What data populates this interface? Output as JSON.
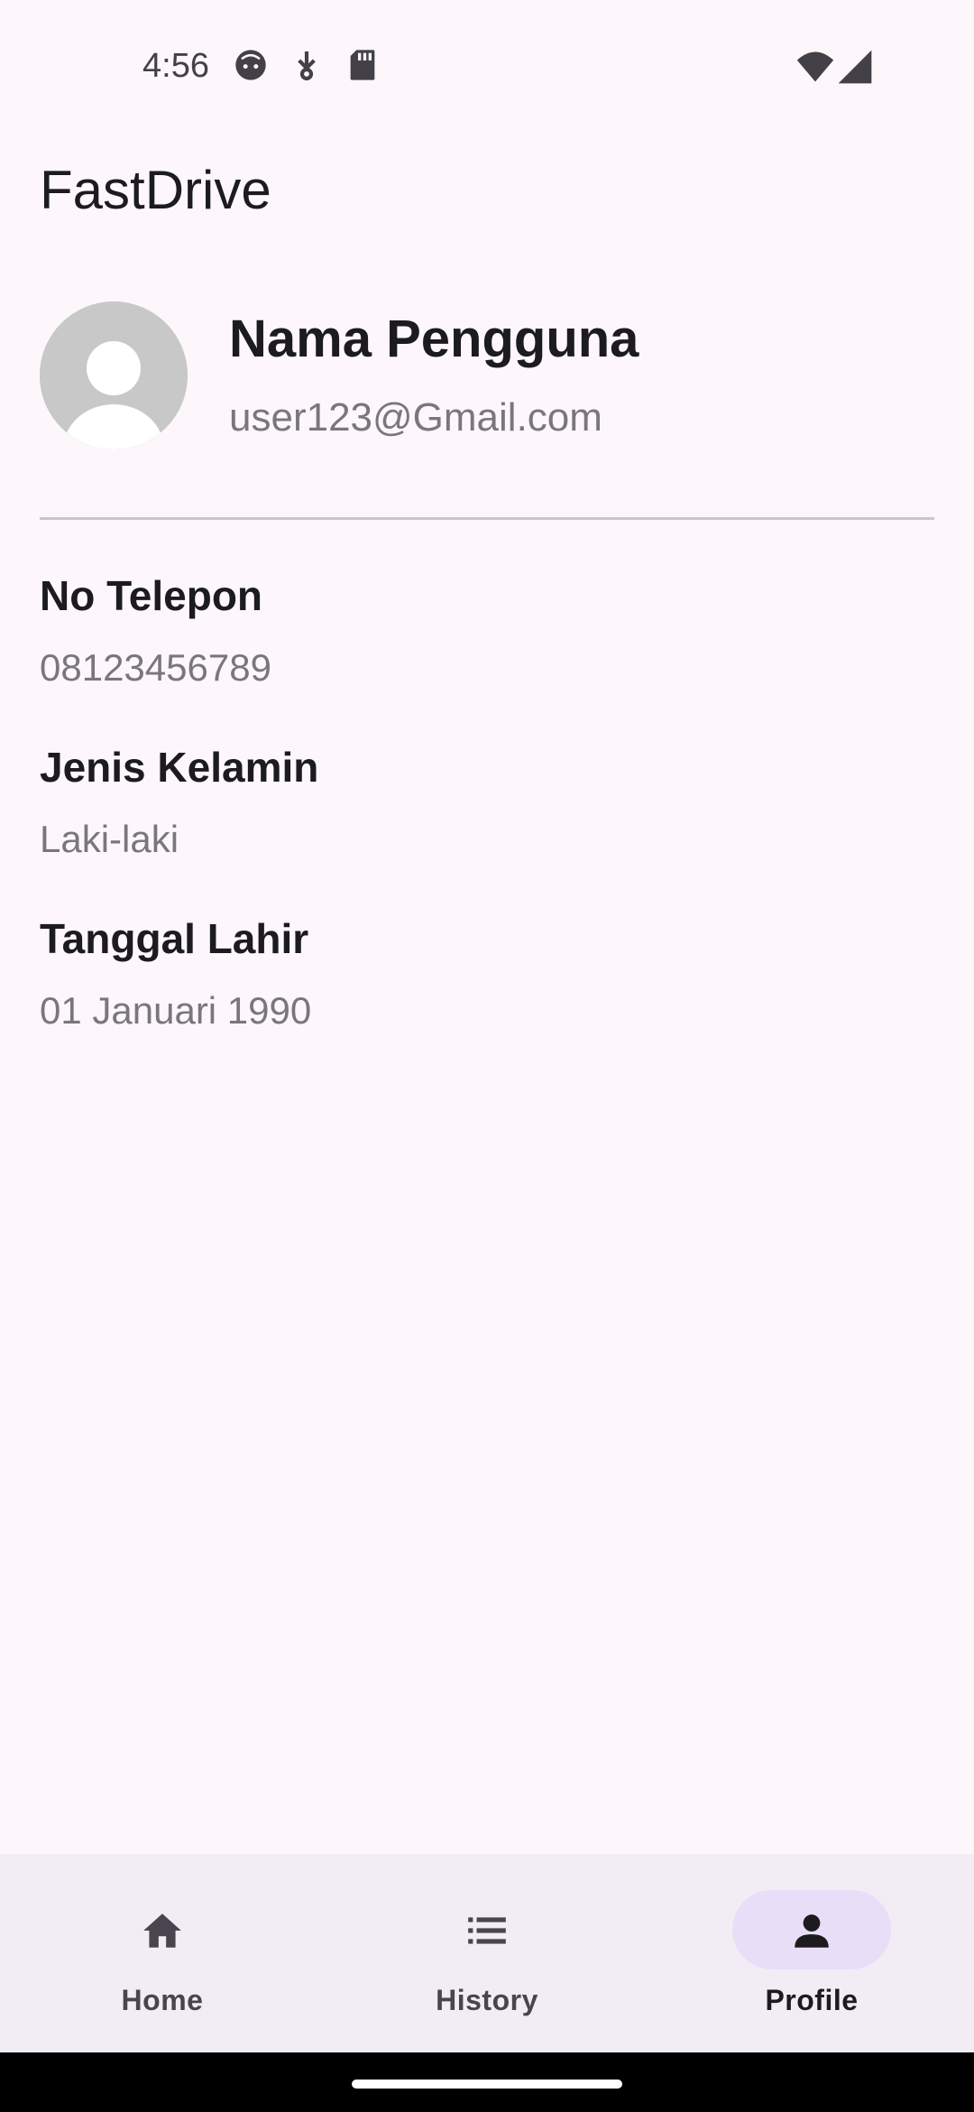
{
  "status_bar": {
    "time": "4:56",
    "icons": [
      "face-icon",
      "usb-debug-icon",
      "sd-card-icon",
      "wifi-icon",
      "signal-icon"
    ]
  },
  "app": {
    "title": "FastDrive"
  },
  "profile": {
    "name": "Nama Pengguna",
    "email": "user123@Gmail.com",
    "avatar_icon": "person-placeholder-icon"
  },
  "fields": [
    {
      "label": "No Telepon",
      "value": "08123456789"
    },
    {
      "label": "Jenis Kelamin",
      "value": "Laki-laki"
    },
    {
      "label": "Tanggal Lahir",
      "value": "01 Januari 1990"
    }
  ],
  "bottom_nav": {
    "items": [
      {
        "label": "Home",
        "icon": "home-icon",
        "active": false
      },
      {
        "label": "History",
        "icon": "list-icon",
        "active": false
      },
      {
        "label": "Profile",
        "icon": "person-icon",
        "active": true
      }
    ]
  },
  "colors": {
    "background": "#fdf7fc",
    "nav_background": "#f2edf5",
    "active_indicator": "#e8def8",
    "secondary_text": "#7a767e"
  }
}
